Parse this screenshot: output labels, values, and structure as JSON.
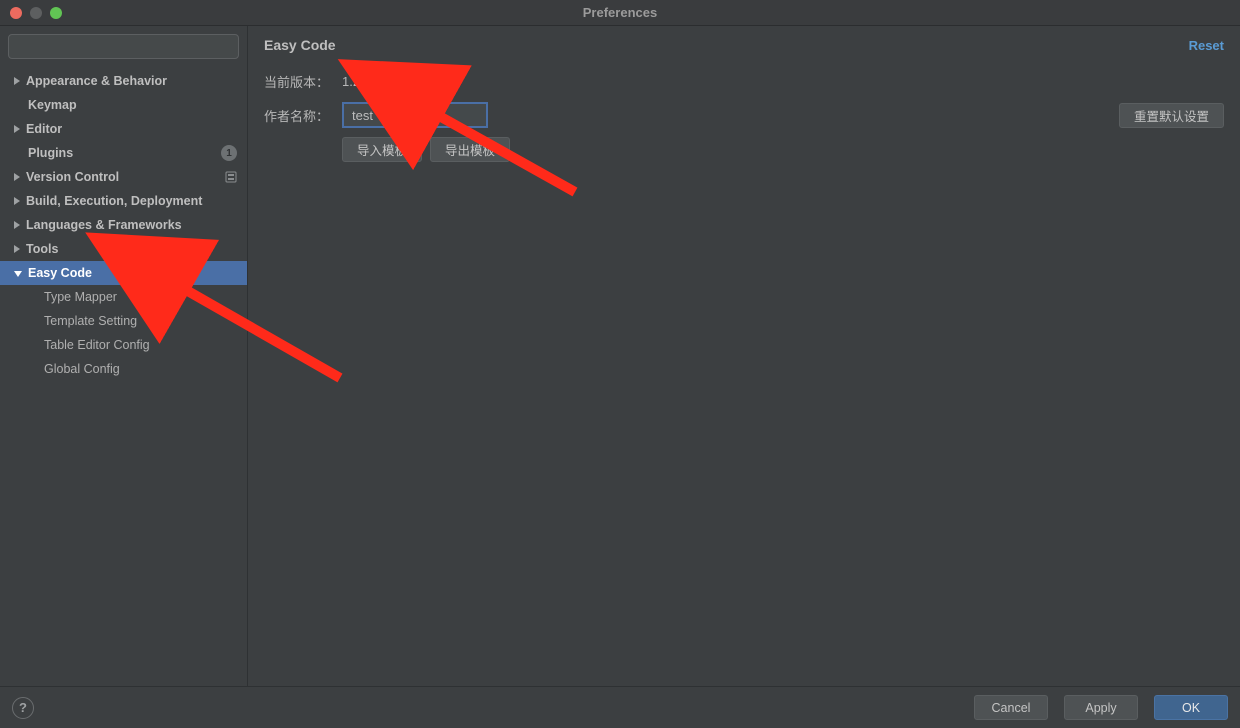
{
  "window": {
    "title": "Preferences"
  },
  "search": {
    "placeholder": ""
  },
  "sidebar": {
    "items": [
      {
        "label": "Appearance & Behavior",
        "arrow": "right"
      },
      {
        "label": "Keymap",
        "arrow": "none"
      },
      {
        "label": "Editor",
        "arrow": "right"
      },
      {
        "label": "Plugins",
        "arrow": "none",
        "badge": "1"
      },
      {
        "label": "Version Control",
        "arrow": "right",
        "vcs_icon": true
      },
      {
        "label": "Build, Execution, Deployment",
        "arrow": "right"
      },
      {
        "label": "Languages & Frameworks",
        "arrow": "right"
      },
      {
        "label": "Tools",
        "arrow": "right"
      },
      {
        "label": "Easy Code",
        "arrow": "down",
        "selected": true
      }
    ],
    "easycode_children": [
      {
        "label": "Type Mapper"
      },
      {
        "label": "Template Setting"
      },
      {
        "label": "Table Editor Config"
      },
      {
        "label": "Global Config"
      }
    ]
  },
  "main": {
    "title": "Easy Code",
    "reset_label": "Reset",
    "version_label": "当前版本：",
    "version_value": "1.2.4",
    "author_label": "作者名称：",
    "author_value": "test",
    "import_btn": "导入模板",
    "export_btn": "导出模板",
    "reset_default_btn": "重置默认设置"
  },
  "footer": {
    "help": "?",
    "cancel": "Cancel",
    "apply": "Apply",
    "ok": "OK"
  },
  "colors": {
    "selection": "#4a6fa6",
    "annotation": "#ff2a1a"
  }
}
